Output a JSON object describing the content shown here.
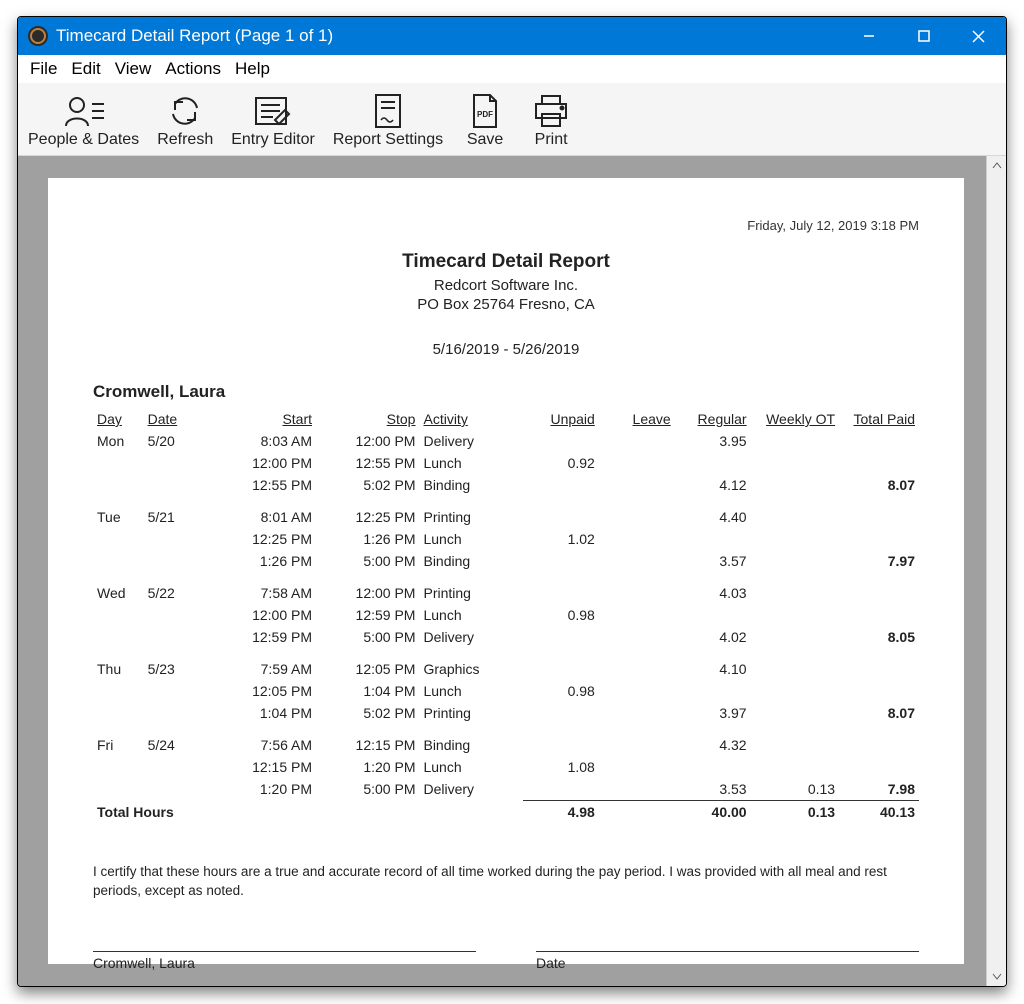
{
  "window": {
    "title": "Timecard Detail Report  (Page 1 of 1)"
  },
  "menu": {
    "file": "File",
    "edit": "Edit",
    "view": "View",
    "actions": "Actions",
    "help": "Help"
  },
  "toolbar": {
    "people": "People & Dates",
    "refresh": "Refresh",
    "editor": "Entry Editor",
    "settings": "Report Settings",
    "save": "Save",
    "print": "Print"
  },
  "report": {
    "print_date": "Friday, July 12, 2019  3:18 PM",
    "title": "Timecard Detail Report",
    "company": "Redcort Software Inc.",
    "address": "PO Box 25764  Fresno, CA",
    "date_range": "5/16/2019 - 5/26/2019",
    "employee": "Cromwell, Laura",
    "headers": {
      "day": "Day",
      "date": "Date",
      "start": "Start",
      "stop": "Stop",
      "activity": "Activity",
      "unpaid": "Unpaid",
      "leave": "Leave",
      "regular": "Regular",
      "wot": "Weekly OT",
      "tp": "Total Paid"
    },
    "days": [
      {
        "day": "Mon",
        "date": "5/20",
        "rows": [
          {
            "start": "8:03 AM",
            "stop": "12:00 PM",
            "activity": "Delivery",
            "unpaid": "",
            "regular": "3.95",
            "wot": "",
            "tp": ""
          },
          {
            "start": "12:00 PM",
            "stop": "12:55 PM",
            "activity": "Lunch",
            "unpaid": "0.92",
            "regular": "",
            "wot": "",
            "tp": ""
          },
          {
            "start": "12:55 PM",
            "stop": "5:02 PM",
            "activity": "Binding",
            "unpaid": "",
            "regular": "4.12",
            "wot": "",
            "tp": "8.07"
          }
        ]
      },
      {
        "day": "Tue",
        "date": "5/21",
        "rows": [
          {
            "start": "8:01 AM",
            "stop": "12:25 PM",
            "activity": "Printing",
            "unpaid": "",
            "regular": "4.40",
            "wot": "",
            "tp": ""
          },
          {
            "start": "12:25 PM",
            "stop": "1:26 PM",
            "activity": "Lunch",
            "unpaid": "1.02",
            "regular": "",
            "wot": "",
            "tp": ""
          },
          {
            "start": "1:26 PM",
            "stop": "5:00 PM",
            "activity": "Binding",
            "unpaid": "",
            "regular": "3.57",
            "wot": "",
            "tp": "7.97"
          }
        ]
      },
      {
        "day": "Wed",
        "date": "5/22",
        "rows": [
          {
            "start": "7:58 AM",
            "stop": "12:00 PM",
            "activity": "Printing",
            "unpaid": "",
            "regular": "4.03",
            "wot": "",
            "tp": ""
          },
          {
            "start": "12:00 PM",
            "stop": "12:59 PM",
            "activity": "Lunch",
            "unpaid": "0.98",
            "regular": "",
            "wot": "",
            "tp": ""
          },
          {
            "start": "12:59 PM",
            "stop": "5:00 PM",
            "activity": "Delivery",
            "unpaid": "",
            "regular": "4.02",
            "wot": "",
            "tp": "8.05"
          }
        ]
      },
      {
        "day": "Thu",
        "date": "5/23",
        "rows": [
          {
            "start": "7:59 AM",
            "stop": "12:05 PM",
            "activity": "Graphics",
            "unpaid": "",
            "regular": "4.10",
            "wot": "",
            "tp": ""
          },
          {
            "start": "12:05 PM",
            "stop": "1:04 PM",
            "activity": "Lunch",
            "unpaid": "0.98",
            "regular": "",
            "wot": "",
            "tp": ""
          },
          {
            "start": "1:04 PM",
            "stop": "5:02 PM",
            "activity": "Printing",
            "unpaid": "",
            "regular": "3.97",
            "wot": "",
            "tp": "8.07"
          }
        ]
      },
      {
        "day": "Fri",
        "date": "5/24",
        "rows": [
          {
            "start": "7:56 AM",
            "stop": "12:15 PM",
            "activity": "Binding",
            "unpaid": "",
            "regular": "4.32",
            "wot": "",
            "tp": ""
          },
          {
            "start": "12:15 PM",
            "stop": "1:20 PM",
            "activity": "Lunch",
            "unpaid": "1.08",
            "regular": "",
            "wot": "",
            "tp": ""
          },
          {
            "start": "1:20 PM",
            "stop": "5:00 PM",
            "activity": "Delivery",
            "unpaid": "",
            "regular": "3.53",
            "wot": "0.13",
            "tp": "7.98"
          }
        ]
      }
    ],
    "totals": {
      "label": "Total Hours",
      "unpaid": "4.98",
      "leave": "",
      "regular": "40.00",
      "wot": "0.13",
      "tp": "40.13"
    },
    "cert": "I certify that these hours are a true and accurate record of all time worked during the pay period. I was provided with all meal and rest periods, except as noted.",
    "sig_name": "Cromwell, Laura",
    "sig_date": "Date"
  }
}
